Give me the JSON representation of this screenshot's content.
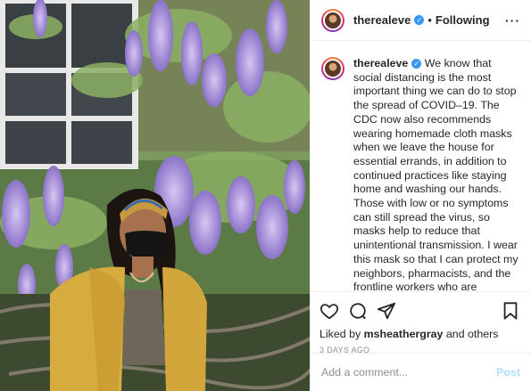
{
  "header": {
    "username": "therealeve",
    "separator": "•",
    "follow_status": "Following",
    "more_icon": "more-options-icon"
  },
  "caption": {
    "username": "therealeve",
    "text": "We know that social distancing is the most important thing we can do to stop the spread of COVID–19. The CDC now also recommends wearing homemade cloth masks when we leave the house for essential errands, in addition to continued practices like staying home and washing our hands. Those with low or no symptoms can still spread the virus, so masks help to reduce that unintentional transmission. I wear this mask so that I can protect my neighbors, pharmacists, and the frontline workers who are sacrificing every day to fight this disease. It's one way we can say 'thank you' and keep each other safe. Who are you masking for?"
  },
  "actions": {
    "icons": [
      "heart-icon",
      "comment-icon",
      "share-icon",
      "bookmark-icon"
    ],
    "likes_prefix": "Liked by",
    "likes_user": "msheathergray",
    "likes_suffix": "and others",
    "timestamp": "3 DAYS AGO"
  },
  "comment": {
    "placeholder": "Add a comment...",
    "post_label": "Post"
  },
  "colors": {
    "verified": "#3897f0",
    "post_button": "#b2dffc",
    "muted_text": "#8e8e8e",
    "divider": "#efefef"
  }
}
